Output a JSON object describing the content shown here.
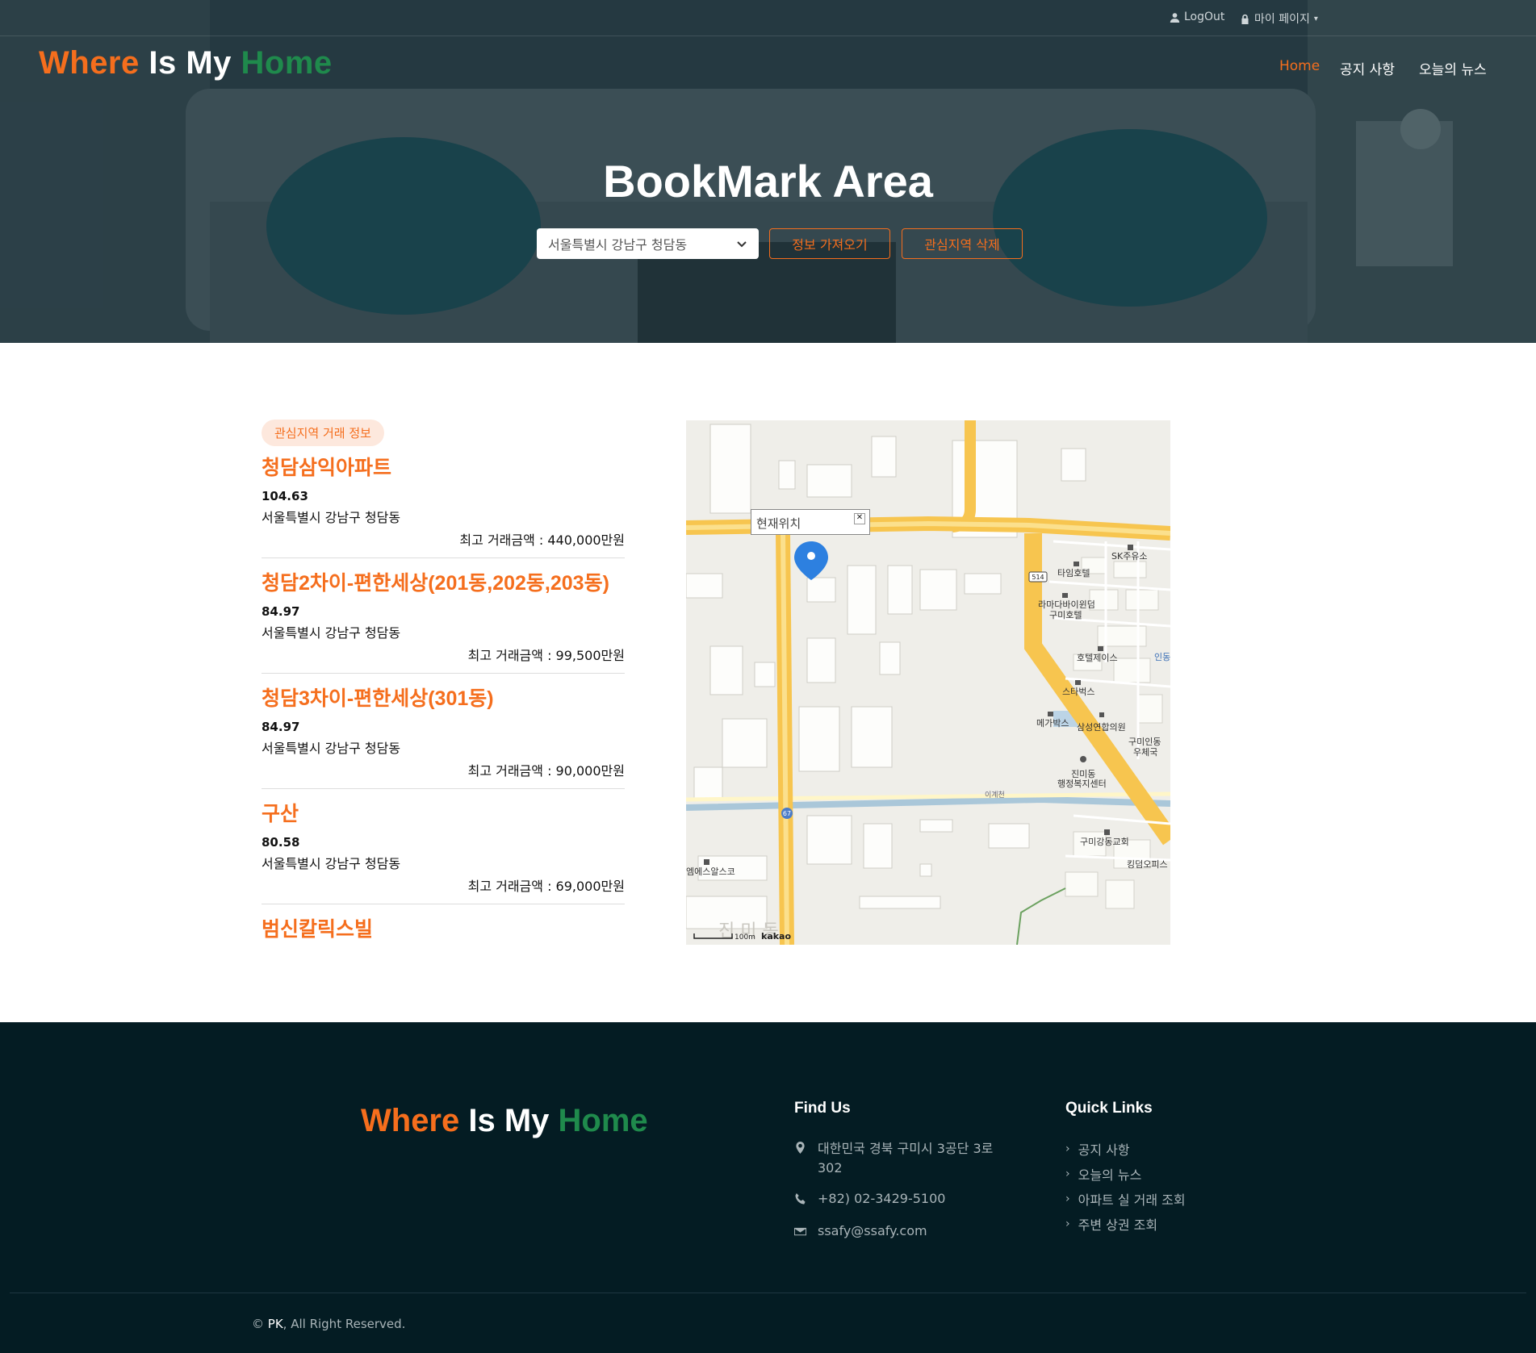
{
  "topbar": {
    "logout": "LogOut",
    "mypage": "마이 페이지"
  },
  "brand": {
    "word1": "Where",
    "word2": "Is My",
    "word3": "Home"
  },
  "nav": {
    "home": "Home",
    "notice": "공지 사항",
    "news": "오늘의 뉴스"
  },
  "hero": {
    "title": "BookMark Area",
    "select_value": "서울특별시 강남구 청담동",
    "fetch_button": "정보 가져오기",
    "delete_button": "관심지역 삭제"
  },
  "section_badge": "관심지역 거래 정보",
  "deals": [
    {
      "name": "청담삼익아파트",
      "area": "104.63",
      "address": "서울특별시 강남구 청담동",
      "price": "최고 거래금액 : 440,000만원"
    },
    {
      "name": "청담2차이-편한세상(201동,202동,203동)",
      "area": "84.97",
      "address": "서울특별시 강남구 청담동",
      "price": "최고 거래금액 : 99,500만원"
    },
    {
      "name": "청담3차이-편한세상(301동)",
      "area": "84.97",
      "address": "서울특별시 강남구 청담동",
      "price": "최고 거래금액 : 90,000만원"
    },
    {
      "name": "구산",
      "area": "80.58",
      "address": "서울특별시 강남구 청담동",
      "price": "최고 거래금액 : 69,000만원"
    },
    {
      "name": "범신칼릭스빌",
      "area": "",
      "address": "",
      "price": ""
    }
  ],
  "map": {
    "infowindow": "현재위치",
    "scale_label": "100m",
    "provider": "kakao",
    "labels": {
      "sk": "SK주유소",
      "tayim": "타임호텔",
      "ramada1": "라마다바이윈덤",
      "ramada2": "구미호텔",
      "hotelj": "호텔제이스",
      "starbucks": "스타벅스",
      "megabox": "메가박스",
      "samsung": "삼성연합의원",
      "post1": "구미인동",
      "post2": "우체국",
      "jinmi1": "진미동",
      "jinmi2": "행정복지센터",
      "church": "구미강동교회",
      "king": "킹덤오피스",
      "ms": "엠에스알스코",
      "road514": "514",
      "road67": "67",
      "stream": "이계천",
      "inner": "인동",
      "dong": "진 미 동"
    }
  },
  "footer": {
    "find_us_title": "Find Us",
    "address": "대한민국 경북 구미시 3공단 3로 302",
    "phone": "+82) 02-3429-5100",
    "email": "ssafy@ssafy.com",
    "quick_links_title": "Quick Links",
    "quick_links": [
      "공지 사항",
      "오늘의 뉴스",
      "아파트 실 거래 조회",
      "주변 상권 조회"
    ],
    "copyright_owner": "PK",
    "copyright_rest": ", All Right Reserved."
  },
  "colors": {
    "accent": "#f56e1d",
    "brand_green": "#1f8a4c",
    "footer_bg": "#041c23",
    "hero_overlay": "#1e3a44"
  },
  "icons": [
    "user-icon",
    "lock-icon",
    "caret-down-icon",
    "chevron-down-icon",
    "map-marker-icon",
    "phone-icon",
    "envelope-icon",
    "chevron-right-icon"
  ]
}
